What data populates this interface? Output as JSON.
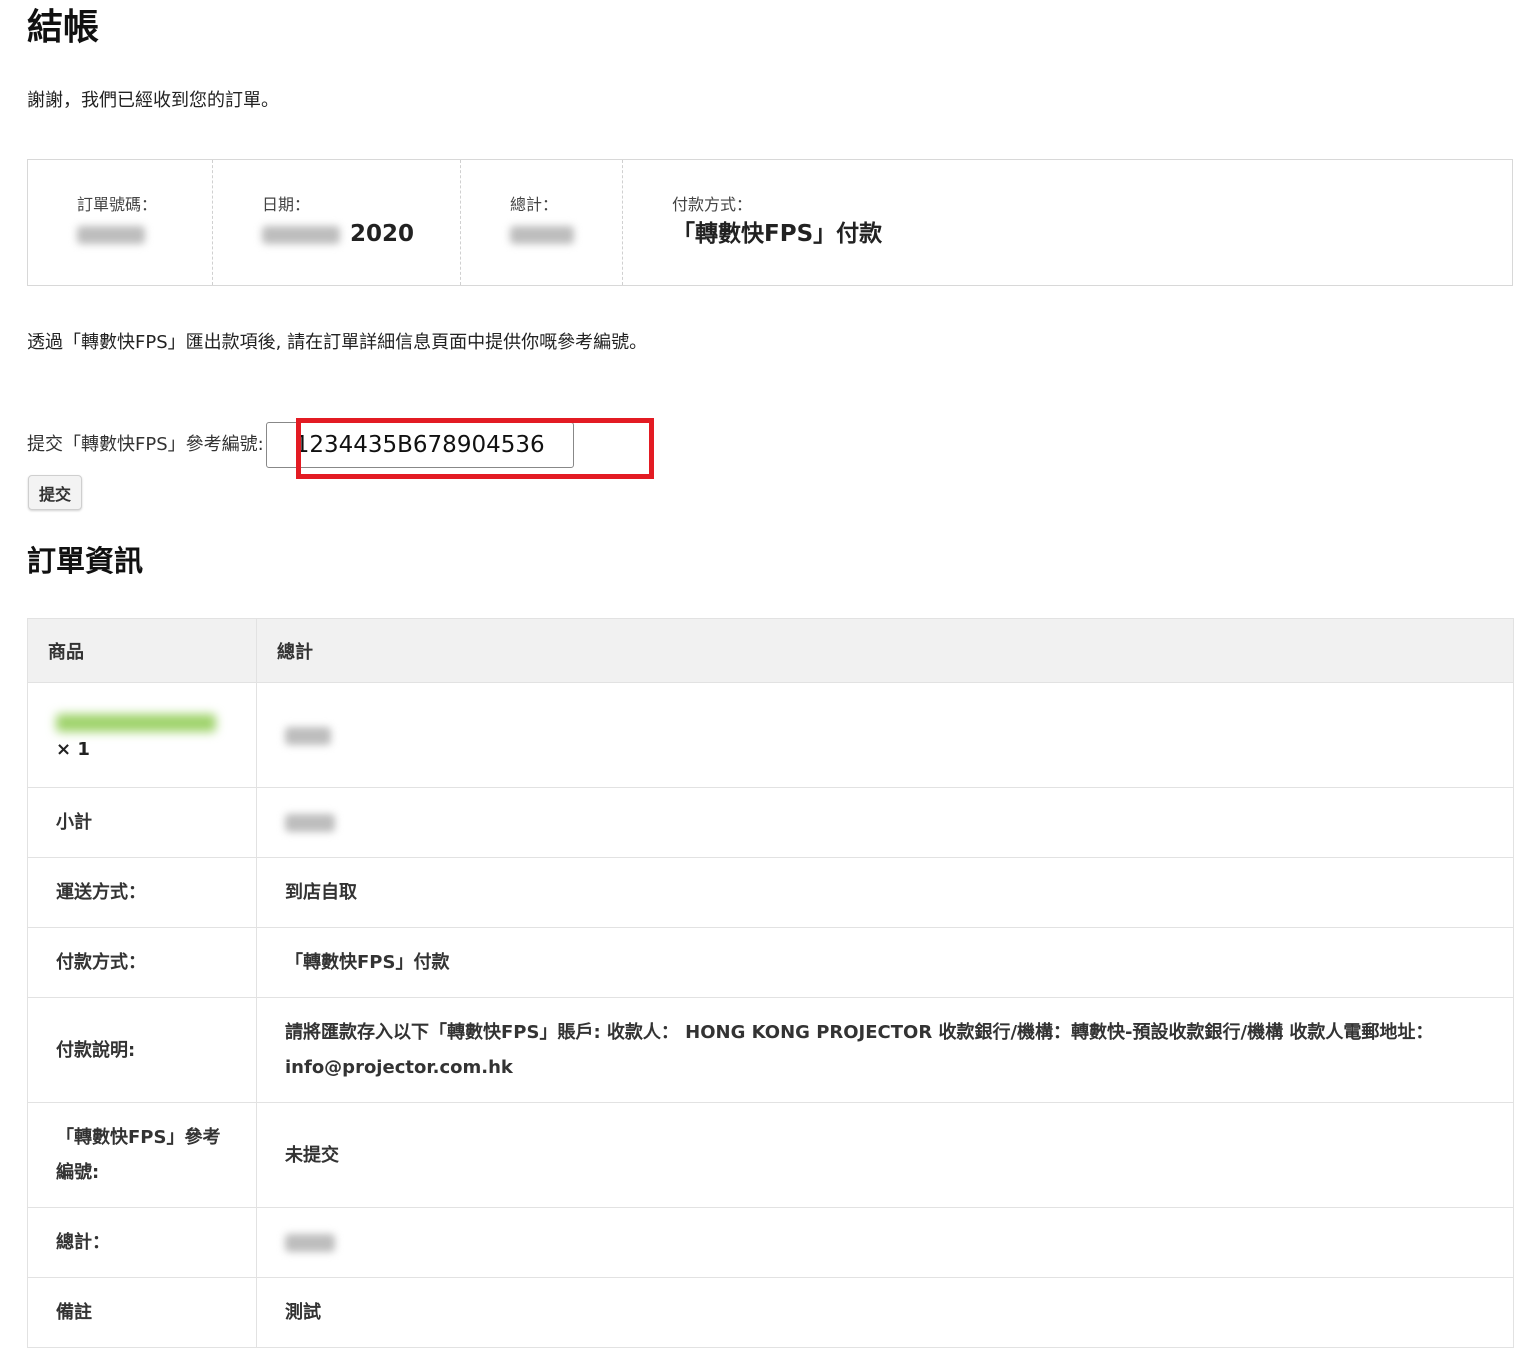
{
  "page": {
    "title": "結帳",
    "thanks_message": "謝謝，我們已經收到您的訂單。"
  },
  "overview": {
    "order_number_label": "訂單號碼：",
    "date_label": "日期：",
    "date_year": "2020",
    "total_label": "總計：",
    "payment_method_label": "付款方式：",
    "payment_method_value": "「轉數快FPS」付款"
  },
  "fps": {
    "note": "透過「轉數快FPS」匯出款項後, 請在訂單詳細信息頁面中提供你嘅參考編號。",
    "ref_label": "提交「轉數快FPS」參考編號:",
    "ref_value": "1234435B678904536",
    "submit_label": "提交"
  },
  "order_details": {
    "title": "訂單資訊",
    "headers": [
      "商品",
      "總計"
    ],
    "product_qty": "× 1",
    "rows": {
      "subtotal_label": "小計",
      "shipping_label": "運送方式：",
      "shipping_value": "到店自取",
      "payment_label": "付款方式：",
      "payment_value": "「轉數快FPS」付款",
      "instructions_label": "付款說明:",
      "instructions_value": "請將匯款存入以下「轉數快FPS」賬戶: 收款人： HONG KONG PROJECTOR 收款銀行/機構：轉數快-預設收款銀行/機構 收款人電郵地址：info@projector.com.hk",
      "fps_ref_label": "「轉數快FPS」參考編號:",
      "fps_ref_value": "未提交",
      "total_label": "總計：",
      "note_label": "備註",
      "note_value": "測試"
    }
  },
  "colors": {
    "highlight": "#e31b23",
    "header_bg": "#f1f1f1",
    "border": "#e2e2e2"
  }
}
